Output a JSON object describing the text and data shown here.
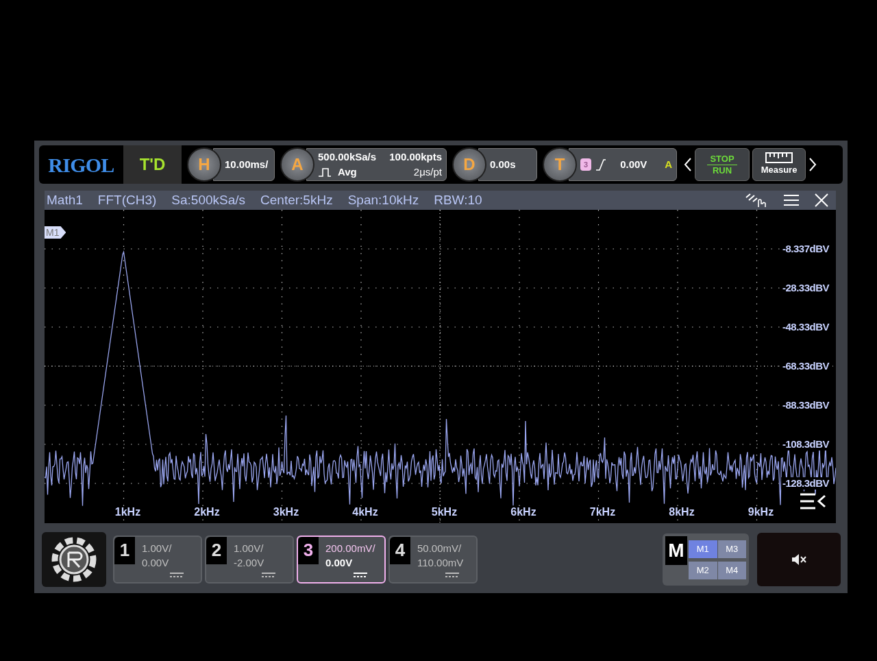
{
  "top_bar": {
    "logo": "RIGOL",
    "trigger_status": "T'D",
    "horizontal": {
      "badge": "H",
      "value": "10.00ms/"
    },
    "acquire": {
      "badge": "A",
      "sample_rate": "500.00kSa/s",
      "memory_depth": "100.00kpts",
      "mode": "Avg",
      "time_per_point": "2μs/pt"
    },
    "delay": {
      "badge": "D",
      "value": "0.00s"
    },
    "trigger": {
      "badge": "T",
      "source": "3",
      "level": "0.00V",
      "sweep": "A"
    },
    "run_control": {
      "top": "STOP",
      "bottom": "RUN"
    },
    "measure": "Measure"
  },
  "math_window": {
    "labels": [
      "Math1",
      "FFT(CH3)",
      "Sa:500kSa/s",
      "Center:5kHz",
      "Span:10kHz",
      "RBW:10"
    ],
    "marker": "M1",
    "y_labels": [
      "-8.337dBV",
      "-28.33dBV",
      "-48.33dBV",
      "-68.33dBV",
      "-88.33dBV",
      "-108.3dBV",
      "-128.3dBV"
    ],
    "x_labels": [
      "1kHz",
      "2kHz",
      "3kHz",
      "4kHz",
      "5kHz",
      "6kHz",
      "7kHz",
      "8kHz",
      "9kHz"
    ]
  },
  "channels": [
    {
      "number": "1",
      "scale": "1.00V/",
      "offset": "0.00V",
      "selected": false
    },
    {
      "number": "2",
      "scale": "1.00V/",
      "offset": "-2.00V",
      "selected": false
    },
    {
      "number": "3",
      "scale": "200.00mV/",
      "offset": "0.00V",
      "selected": true
    },
    {
      "number": "4",
      "scale": "50.00mV/",
      "offset": "110.00mV",
      "selected": false
    }
  ],
  "math_menu": {
    "badge": "M",
    "items": [
      {
        "label": "M1",
        "selected": true
      },
      {
        "label": "M3",
        "selected": false
      },
      {
        "label": "M2",
        "selected": false
      },
      {
        "label": "M4",
        "selected": false
      }
    ]
  }
}
